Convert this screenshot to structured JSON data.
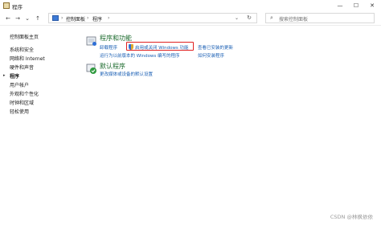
{
  "window": {
    "title": "程序",
    "controls": {
      "minimize": "—",
      "maximize": "☐",
      "close": "✕"
    }
  },
  "addressbar": {
    "back": "←",
    "forward": "→",
    "recent": "⌄",
    "up": "↑",
    "breadcrumb": [
      "控制面板",
      "程序"
    ],
    "separator": "›",
    "dropdown": "⌄",
    "refresh": "↻",
    "search_placeholder": "搜索控制面板",
    "search_glyph": "⌕"
  },
  "sidebar": {
    "items": [
      "控制面板主页",
      "系统和安全",
      "网络和 Internet",
      "硬件和声音",
      "程序",
      "用户帐户",
      "外观和个性化",
      "时钟和区域",
      "轻松使用"
    ],
    "current_index": 4,
    "current_marker": "▸"
  },
  "sections": [
    {
      "title": "程序和功能",
      "icon": "programs-features-icon",
      "links": [
        "卸载程序",
        "启用或关闭 Windows 功能",
        "查看已安装的更新",
        "运行为以前版本的 Windows 编写的程序",
        "如何安装程序"
      ]
    },
    {
      "title": "默认程序",
      "icon": "default-programs-icon",
      "links": [
        "更改媒体或设备的默认设置"
      ]
    }
  ],
  "highlight_color": "#e02020",
  "watermark": "CSDN @林枫依依"
}
